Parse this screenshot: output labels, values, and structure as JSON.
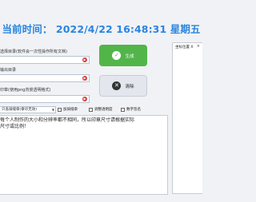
{
  "clock": {
    "label": "当前时间：",
    "date": "2022/4/22",
    "time": "16:48:31",
    "weekday": "星期五"
  },
  "hints": {
    "source_dir": "选择目录(软件会一次性操作所有文档)",
    "output_dir": "输出目录",
    "stamp_image": "印章(使用png背景透明格式)"
  },
  "buttons": {
    "generate": "生成",
    "clear": "清除"
  },
  "options": {
    "stamp_mode_value": "只盖骑缝章(章尽无效)",
    "add_riding_seam": "加骑缝章",
    "adjust_transparency": "调整透明度",
    "digital_signature": "数字签名"
  },
  "output": {
    "lines": [
      "每个人制作的大小和分辨率都不相同，所以印章尺寸请根据实际",
      "尺寸或比例！"
    ]
  },
  "side_panel": {
    "title": "坐标位置 X",
    "close": "×"
  },
  "colors": {
    "clock": "#2b84e0",
    "generate_button": "#52b54a",
    "required_marker": "#d43a3a"
  },
  "icons": {
    "generate": "check-circle-icon",
    "clear": "x-circle-icon",
    "field_marker": "arrow-right-icon"
  }
}
